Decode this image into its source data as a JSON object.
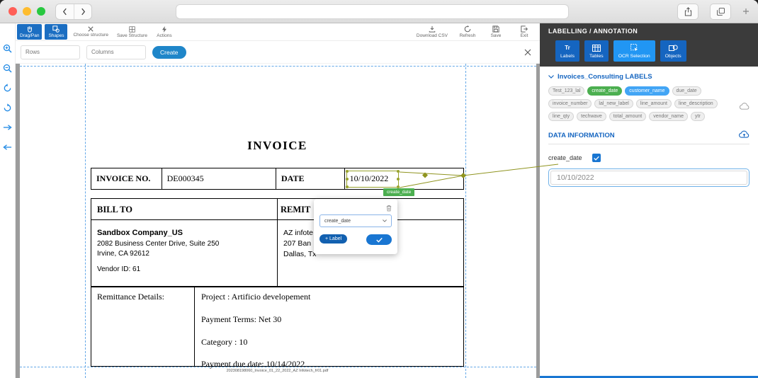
{
  "toolbar": {
    "drag_pan": "Drag/Pan",
    "shapes": "Shapes",
    "choose_structure": "Choose structure",
    "save_structure": "Save Structure",
    "actions": "Actions",
    "download_csv": "Download CSV",
    "refresh": "Refresh",
    "save": "Save",
    "exit": "Exit"
  },
  "structure_bar": {
    "rows_placeholder": "Rows",
    "columns_placeholder": "Columns",
    "create_label": "Create"
  },
  "document": {
    "title": "INVOICE",
    "invoice_no_label": "INVOICE NO.",
    "invoice_no_value": "DE000345",
    "date_label": "DATE",
    "date_value": "10/10/2022",
    "selection_tag": "create_date",
    "bill_to_header": "BILL TO",
    "remit_header": "REMIT",
    "bill_to_company": "Sandbox Company_US",
    "bill_to_address1": "2082 Business Center Drive, Suite 250",
    "bill_to_address2": "Irvine, CA 92612",
    "bill_to_vendor": "Vendor ID: 61",
    "remit_line1": "AZ infote",
    "remit_line2": "207 Ban",
    "remit_line3": "Dallas, Tx",
    "remittance_label": "Remittance Details:",
    "project_line": "Project : Artificio developement",
    "terms_line": "Payment Terms: Net 30",
    "category_line": "Category : 10",
    "due_line": "Payment due date: 10/14/2022",
    "filename": "202308198060_Invoice_01_22_2022_AZ Infotech_fr01.pdf"
  },
  "popup": {
    "selected_label": "create_date",
    "add_label_button": "+ Label"
  },
  "panel": {
    "title": "LABELLING / ANNOTATION",
    "labels_tab_icon": "Tr",
    "tabs": [
      "Labels",
      "Tables",
      "OCR Selection",
      "Objects"
    ],
    "labels_section_title": "Invoices_Consulting LABELS",
    "chips": [
      "Test_123_lal",
      "create_date",
      "customer_name",
      "due_date",
      "invoice_number",
      "lal_new_label",
      "line_amount",
      "line_description",
      "line_qty",
      "techwave",
      "total_amount",
      "vendor_name",
      "ytr"
    ],
    "data_information_title": "DATA INFORMATION",
    "field_label": "create_date",
    "field_value": "10/10/2022"
  },
  "colors": {
    "accent_blue": "#1b6ec2",
    "active_tab_blue": "#2196f3",
    "chip_green": "#4caf50",
    "chip_blue": "#42a5f5",
    "connector_olive": "#8f941f",
    "panel_dark": "#3b3b3b",
    "dash_blue": "#64a8e8"
  }
}
